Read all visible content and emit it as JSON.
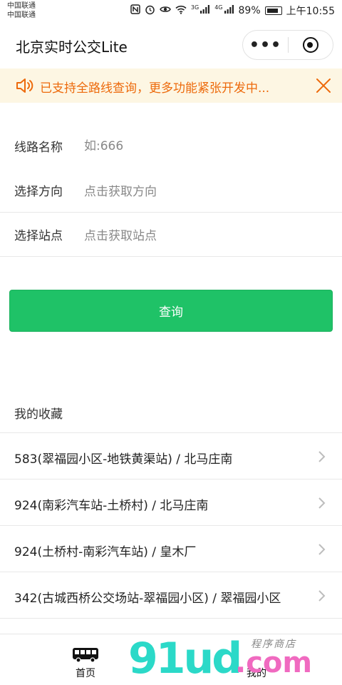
{
  "status_bar": {
    "carrier_1": "中国联通",
    "carrier_2": "中国联通",
    "network_1": "3G",
    "network_2": "4G",
    "battery": "89%",
    "time": "上午10:55"
  },
  "nav": {
    "title": "北京实时公交Lite",
    "more_glyph": "•••"
  },
  "notice": {
    "text": "已支持全路线查询，更多功能紧张开发中...",
    "color": "#ed6a0c",
    "background": "#fdf6e3"
  },
  "form": {
    "route": {
      "label": "线路名称",
      "placeholder": "如:666",
      "value": ""
    },
    "direction": {
      "label": "选择方向",
      "value": "点击获取方向"
    },
    "station": {
      "label": "选择站点",
      "value": "点击获取站点"
    }
  },
  "query_button": {
    "label": "查询",
    "color": "#1fc267"
  },
  "favorites": {
    "title": "我的收藏",
    "items": [
      {
        "text": "583(翠福园小区-地铁黄渠站) / 北马庄南"
      },
      {
        "text": "924(南彩汽车站-土桥村) / 北马庄南"
      },
      {
        "text": "924(土桥村-南彩汽车站) / 皇木厂"
      },
      {
        "text": "342(古城西桥公交场站-翠福园小区) / 翠福园小区"
      }
    ]
  },
  "tabbar": {
    "home_label": "首页",
    "mine_label": "我的"
  },
  "watermark": {
    "brand_a": "91ud",
    "brand_b": ".com",
    "shop": "程序商店"
  }
}
